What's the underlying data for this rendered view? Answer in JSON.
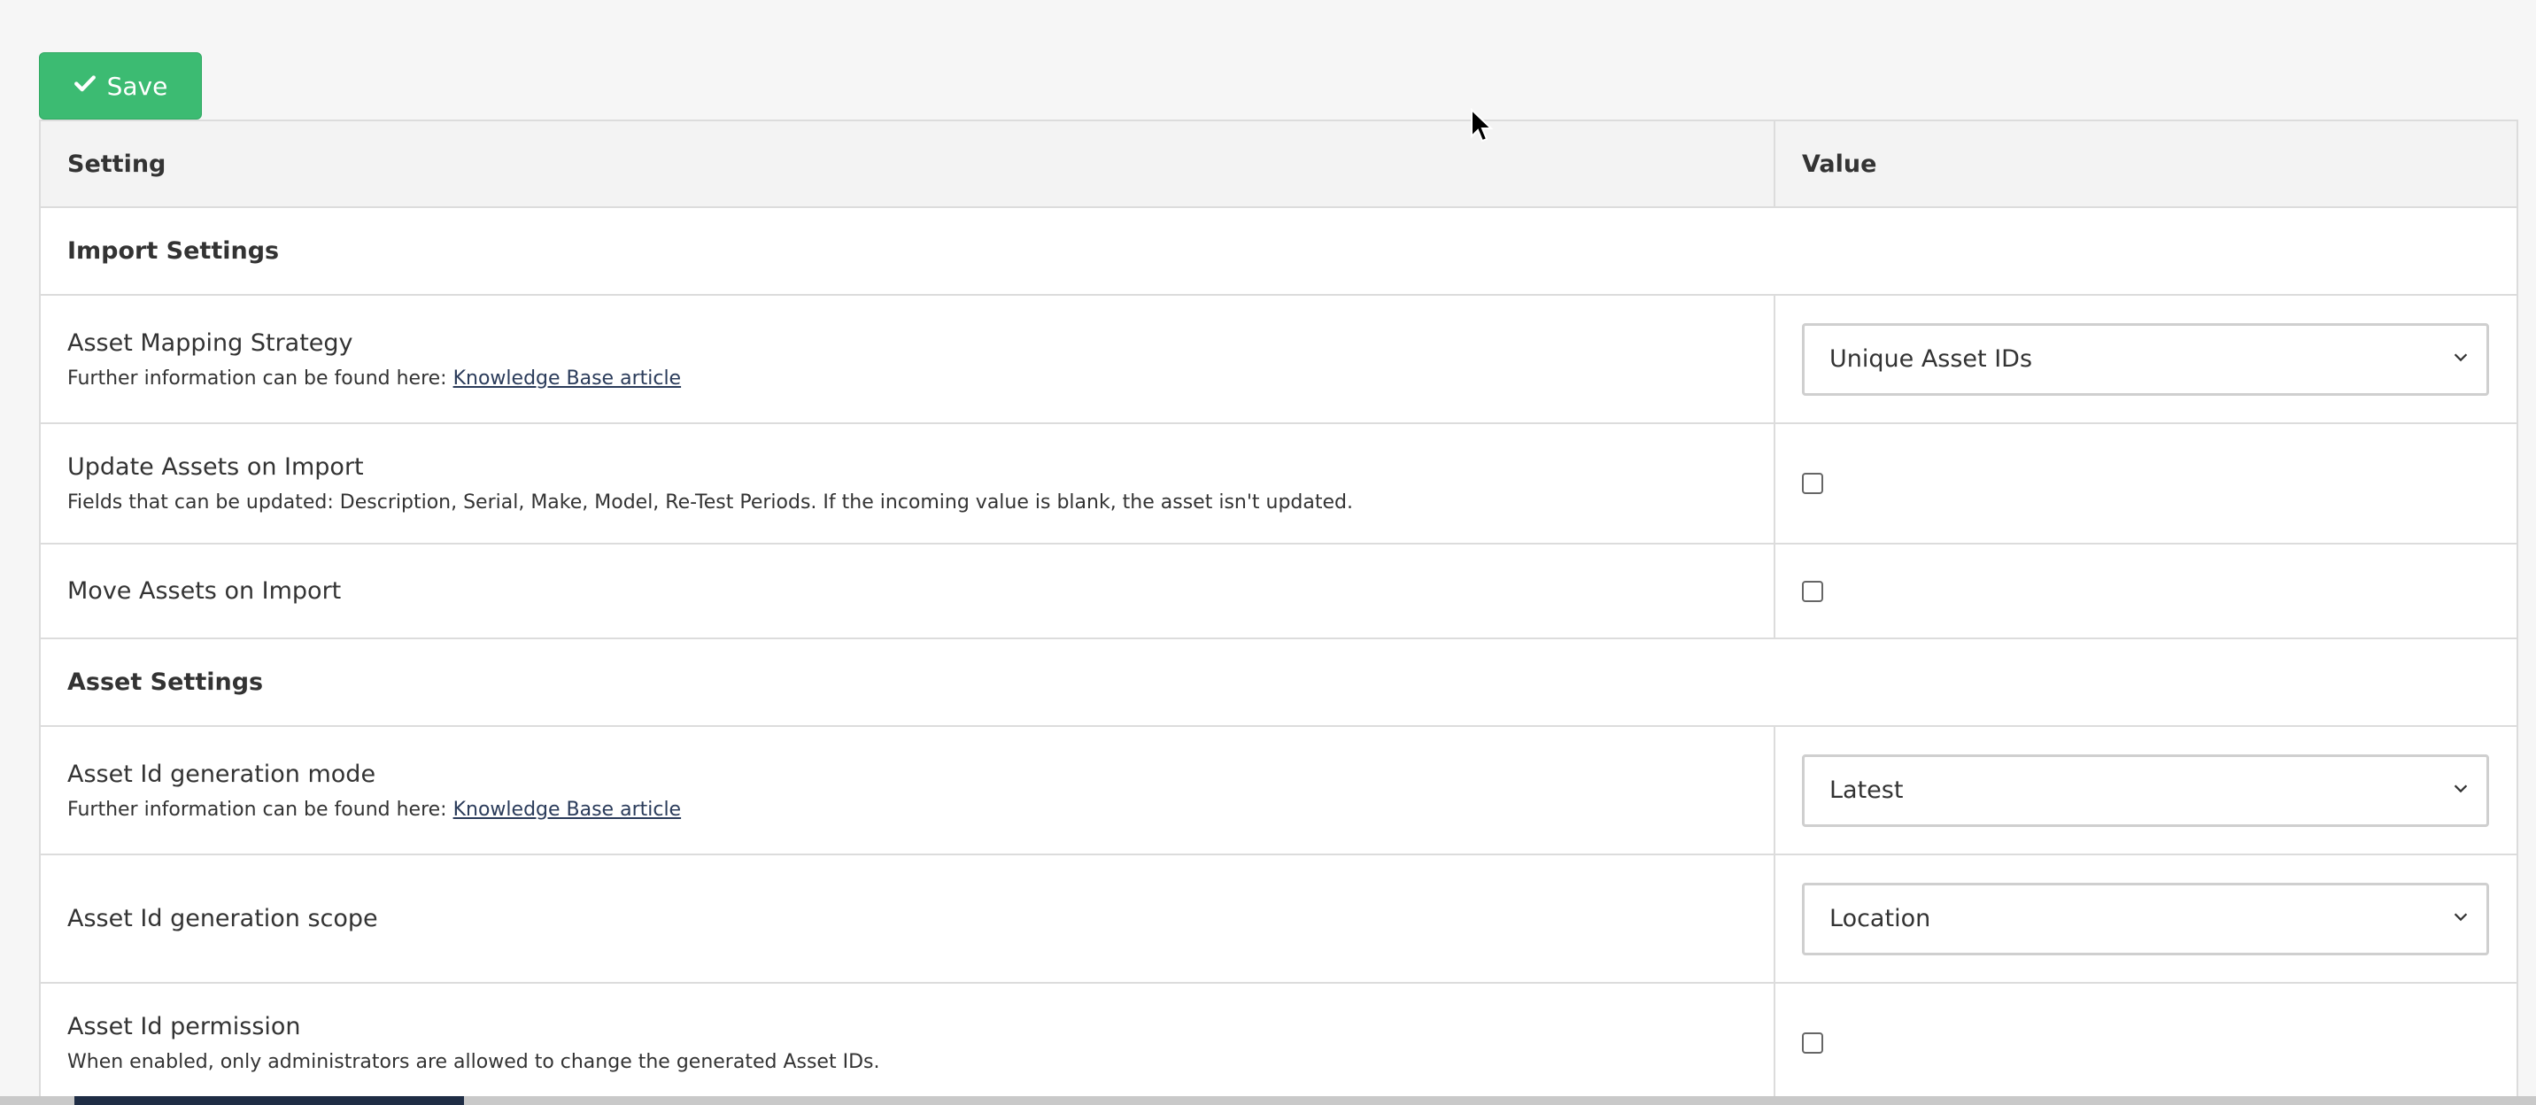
{
  "toolbar": {
    "save_label": "Save"
  },
  "table": {
    "headers": {
      "setting": "Setting",
      "value": "Value"
    },
    "sections": [
      {
        "title": "Import Settings",
        "rows": [
          {
            "title": "Asset Mapping Strategy",
            "desc_prefix": "Further information can be found here: ",
            "link": "Knowledge Base article",
            "control": "select",
            "value": "Unique Asset IDs"
          },
          {
            "title": "Update Assets on Import",
            "desc": "Fields that can be updated: Description, Serial, Make, Model, Re-Test Periods. If the incoming value is blank, the asset isn't updated.",
            "control": "checkbox",
            "checked": false
          },
          {
            "title": "Move Assets on Import",
            "control": "checkbox",
            "checked": false
          }
        ]
      },
      {
        "title": "Asset Settings",
        "rows": [
          {
            "title": "Asset Id generation mode",
            "desc_prefix": "Further information can be found here: ",
            "link": "Knowledge Base article",
            "control": "select",
            "value": "Latest"
          },
          {
            "title": "Asset Id generation scope",
            "control": "select",
            "value": "Location"
          },
          {
            "title": "Asset Id permission",
            "desc": "When enabled, only administrators are allowed to change the generated Asset IDs.",
            "control": "checkbox",
            "checked": false
          }
        ]
      }
    ]
  },
  "colors": {
    "save_button": "#3cbb72",
    "link": "#2a3b5a"
  }
}
